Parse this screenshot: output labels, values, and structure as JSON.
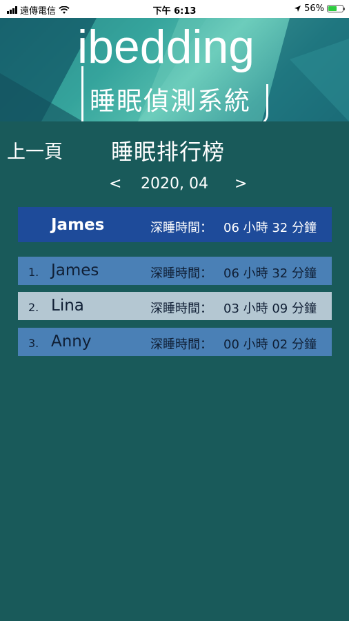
{
  "status_bar": {
    "carrier": "遠傳電信",
    "time": "下午 6:13",
    "battery": "56%",
    "battery_level": 0.56
  },
  "banner": {
    "logo_word": "ibedding",
    "logo_subtitle": "睡眠偵測系統"
  },
  "header": {
    "back_label": "上一頁",
    "title": "睡眠排行榜"
  },
  "month_nav": {
    "prev": "<",
    "date": "2020, 04",
    "next": ">"
  },
  "current_user": {
    "name": "James",
    "label": "深睡時間：",
    "value": "06 小時 32 分鐘"
  },
  "ranking": [
    {
      "rank": "1.",
      "name": "James",
      "label": "深睡時間：",
      "value": "06 小時 32 分鐘"
    },
    {
      "rank": "2.",
      "name": "Lina",
      "label": "深睡時間：",
      "value": "03 小時 09 分鐘"
    },
    {
      "rank": "3.",
      "name": "Anny",
      "label": "深睡時間：",
      "value": "00 小時 02 分鐘"
    }
  ],
  "colors": {
    "background": "#195a5a",
    "current_user_row": "#1e4b9a",
    "row_blue": "#4a80b6",
    "row_light": "#b4c7d2"
  }
}
